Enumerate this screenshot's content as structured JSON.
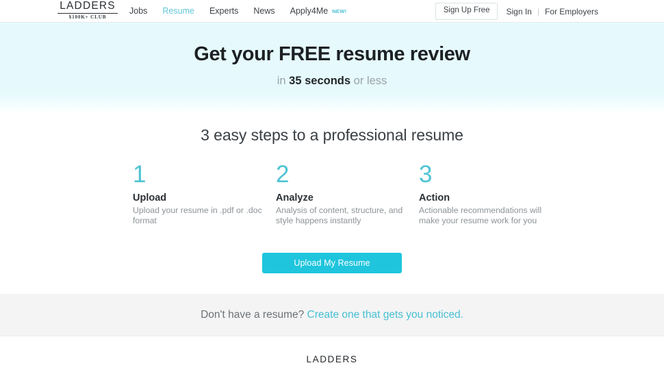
{
  "colors": {
    "accent_teal": "#1fc5dd",
    "accent_light": "#4ec3d4",
    "hero_bg": "#e6fafd",
    "band_bg": "#f4f4f5",
    "text_dark": "#1d2124",
    "text_muted": "#8c9397"
  },
  "nav": {
    "logo_word": "LADDERS",
    "logo_sub": "$100K+ CLUB",
    "links": [
      {
        "label": "Jobs",
        "active": false
      },
      {
        "label": "Resume",
        "active": true
      },
      {
        "label": "Experts",
        "active": false
      },
      {
        "label": "News",
        "active": false
      }
    ],
    "apply_label": "Apply4Me",
    "apply_badge": "NEW!",
    "signup_label": "Sign Up Free",
    "signin_label": "Sign In",
    "separator": "|",
    "employers_label": "For Employers"
  },
  "hero": {
    "title": "Get your FREE resume review",
    "sub_prefix": "in ",
    "sub_strong": "35 seconds",
    "sub_suffix": " or less"
  },
  "steps": {
    "heading": "3 easy steps to a professional resume",
    "items": [
      {
        "number": "1",
        "title": "Upload",
        "desc": "Upload your resume in .pdf or .doc format"
      },
      {
        "number": "2",
        "title": "Analyze",
        "desc": "Analysis of content, structure, and style happens instantly"
      },
      {
        "number": "3",
        "title": "Action",
        "desc": "Actionable recommendations will make your resume work for you"
      }
    ]
  },
  "cta": {
    "label": "Upload My Resume"
  },
  "band": {
    "text": "Don't have a resume? ",
    "link": "Create one that gets you noticed."
  },
  "footer": {
    "logo": "LADDERS"
  }
}
